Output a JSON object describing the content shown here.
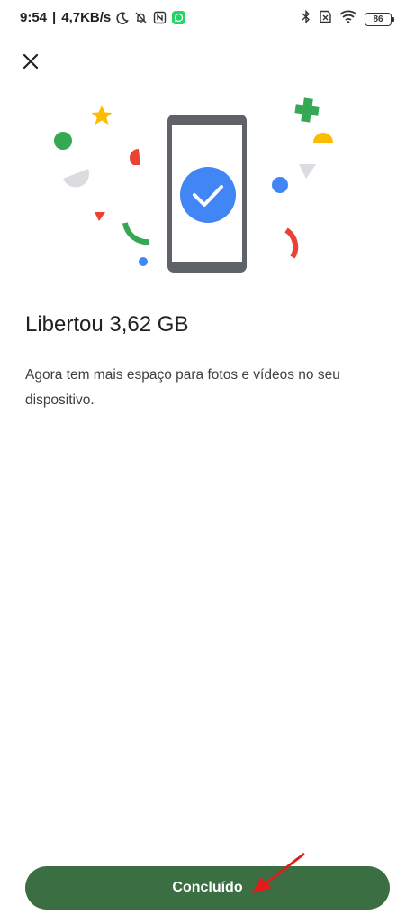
{
  "status_bar": {
    "time": "9:54",
    "speed": "4,7KB/s",
    "battery": "86",
    "icons": [
      "moon-icon",
      "bell-off-icon",
      "nfc-icon",
      "whatsapp-icon",
      "bluetooth-icon",
      "sim-off-icon",
      "wifi-icon",
      "battery-icon"
    ]
  },
  "header": {
    "close_icon": "close-icon"
  },
  "content": {
    "title": "Libertou 3,62 GB",
    "description": "Agora tem mais espaço para fotos e vídeos no seu dispositivo."
  },
  "footer": {
    "done_label": "Concluído"
  },
  "colors": {
    "button": "#3b6e43",
    "check_circle": "#4285f4",
    "phone_frame": "#5f6368",
    "confetti_green": "#34a853",
    "confetti_red": "#ea4335",
    "confetti_yellow": "#fbbc04",
    "confetti_blue": "#4285f4",
    "confetti_gray": "#dadce0"
  }
}
